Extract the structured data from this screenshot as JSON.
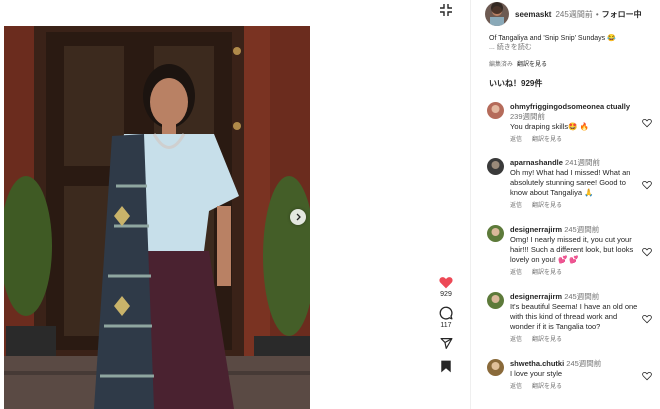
{
  "post": {
    "username": "seemaskt",
    "time": "245週間前",
    "dot": "•",
    "follow_label": "フォロー中",
    "caption_line1": "Of Tangaliya and 'Snip Snip' Sundays 😂",
    "caption_more": "... 続きを読む",
    "edited_label": "編集済み",
    "see_translation": "翻訳を見る",
    "likes_label": "いいね！929件"
  },
  "actions": {
    "like_count": "929",
    "comment_count": "117"
  },
  "comments": [
    {
      "user": "ohmyfriggingodsomeonea ctually",
      "time": "239週間前",
      "text": "You draping skills🤩 🔥",
      "reply": "返信",
      "translate": "翻訳を見る",
      "avatar_color": "#b56b5a"
    },
    {
      "user": "aparnashandle",
      "time": "241週間前",
      "text": "Oh my! What had I missed! What an absolutely stunning saree! Good to know about Tangaliya 🙏",
      "reply": "返信",
      "translate": "翻訳を見る",
      "avatar_color": "#3a3a3a"
    },
    {
      "user": "designerrajirm",
      "time": "245週間前",
      "text": "Omg! I nearly missed it, you cut your hair!!! Such a different look, but looks lovely on you! 💕 💕",
      "reply": "返信",
      "translate": "翻訳を見る",
      "avatar_color": "#5d7a3a"
    },
    {
      "user": "designerrajirm",
      "time": "245週間前",
      "text": "It's beautiful Seema! I have an old one with this kind of thread work and wonder if it is Tangalia too?",
      "reply": "返信",
      "translate": "翻訳を見る",
      "avatar_color": "#5d7a3a"
    },
    {
      "user": "shwetha.chutki",
      "time": "245週間前",
      "text": "I love your style",
      "reply": "返信",
      "translate": "翻訳を見る",
      "avatar_color": "#8a6a3a"
    }
  ],
  "colors": {
    "like_heart": "#ed4956",
    "text": "#262626",
    "muted": "#737373"
  },
  "icons": [
    "collapse-icon",
    "chevron-right-icon",
    "heart-icon",
    "comment-icon",
    "share-icon",
    "bookmark-icon"
  ]
}
